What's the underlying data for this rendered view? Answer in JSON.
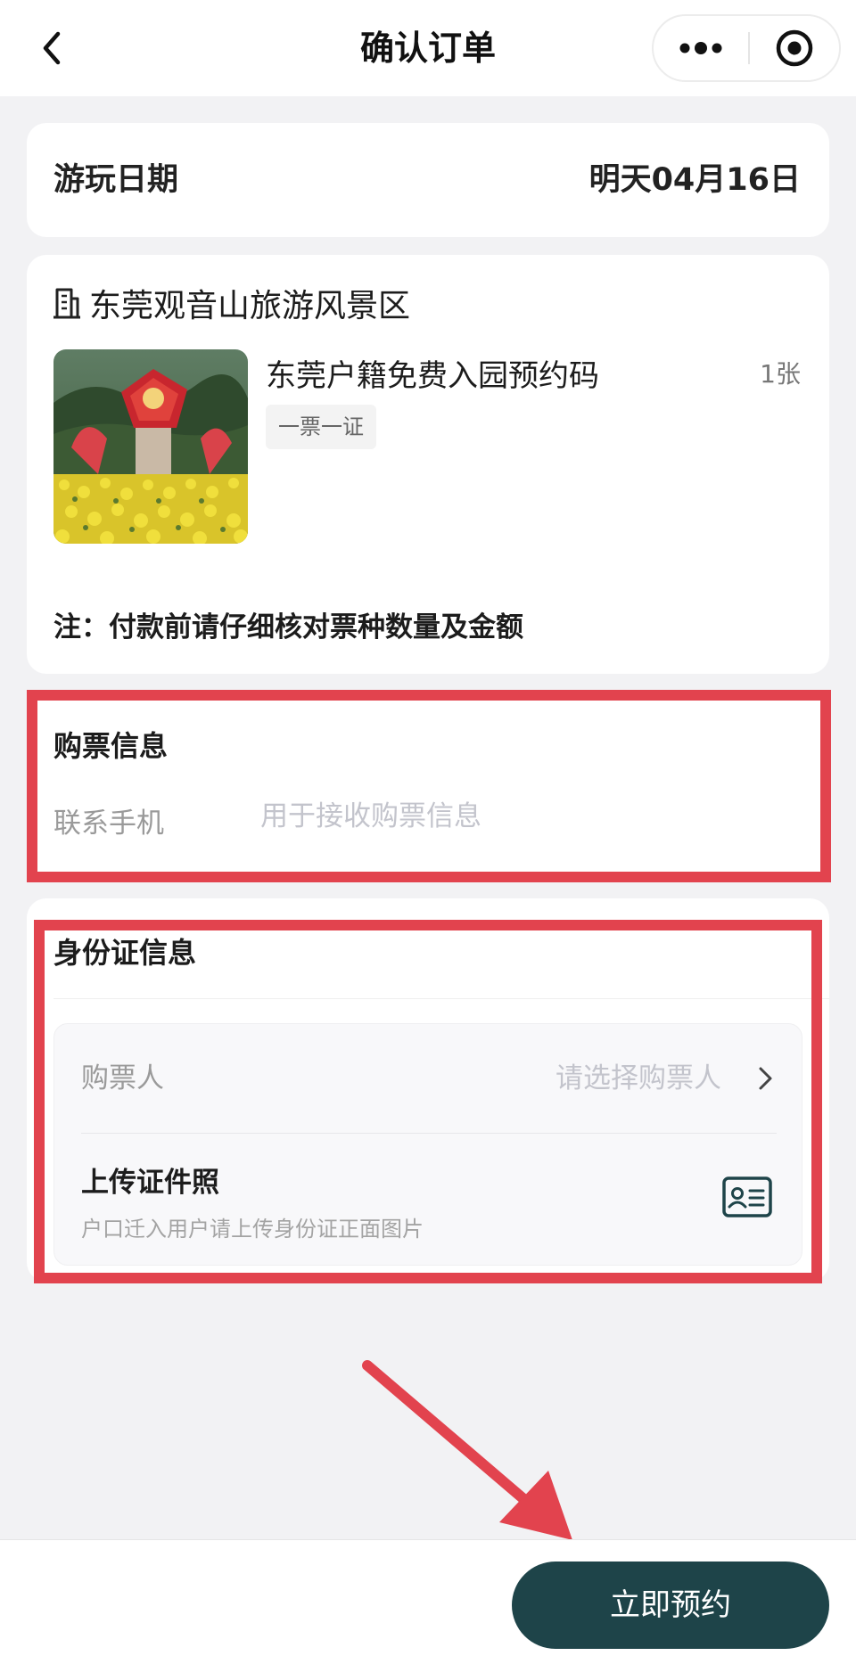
{
  "nav": {
    "title": "确认订单",
    "back_icon": "chevron-left-icon",
    "more_icon": "more-dots-icon",
    "close_icon": "target-close-icon"
  },
  "visit": {
    "label": "游玩日期",
    "date": "明天04月16日"
  },
  "scenic": {
    "icon": "building-icon",
    "name": "东莞观音山旅游风景区",
    "ticket": {
      "name": "东莞户籍免费入园预约码",
      "quantity": "1张",
      "tag": "一票一证"
    },
    "note": "注：付款前请仔细核对票种数量及金额"
  },
  "purchase_info": {
    "title": "购票信息",
    "phone_label": "联系手机",
    "phone_placeholder": "用于接收购票信息",
    "phone_value": ""
  },
  "id_info": {
    "title": "身份证信息",
    "buyer_label": "购票人",
    "buyer_placeholder": "请选择购票人",
    "upload_title": "上传证件照",
    "upload_hint": "户口迁入用户请上传身份证正面图片",
    "upload_icon": "id-card-icon"
  },
  "bottom": {
    "book_button": "立即预约"
  },
  "colors": {
    "primary": "#1e4449",
    "annotation": "#e2434e",
    "background": "#f2f2f4",
    "placeholder": "#c3c4cc"
  }
}
